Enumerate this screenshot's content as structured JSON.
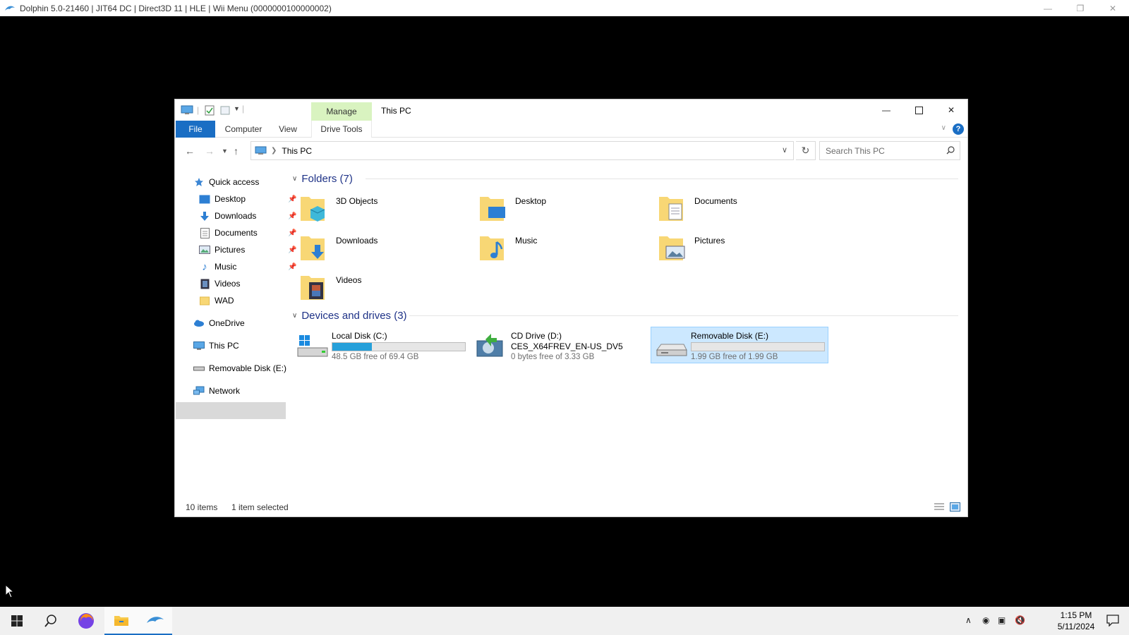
{
  "dolphin": {
    "title": "Dolphin 5.0-21460 | JIT64 DC | Direct3D 11 | HLE | Wii Menu (0000000100000002)"
  },
  "explorer": {
    "window_title": "This PC",
    "ribbon": {
      "contextual_group": "Manage",
      "tabs": {
        "file": "File",
        "computer": "Computer",
        "view": "View",
        "drive_tools": "Drive Tools"
      },
      "help": "?"
    },
    "address": {
      "crumb": "This PC",
      "search_placeholder": "Search This PC"
    },
    "nav_pane": {
      "quick_access": "Quick access",
      "quick_items": [
        {
          "label": "Desktop",
          "pinned": true
        },
        {
          "label": "Downloads",
          "pinned": true
        },
        {
          "label": "Documents",
          "pinned": true
        },
        {
          "label": "Pictures",
          "pinned": true
        },
        {
          "label": "Music",
          "pinned": true
        },
        {
          "label": "Videos",
          "pinned": false
        },
        {
          "label": "WAD",
          "pinned": false
        }
      ],
      "onedrive": "OneDrive",
      "this_pc": "This PC",
      "removable": "Removable Disk (E:)",
      "network": "Network"
    },
    "folders": {
      "header": "Folders (7)",
      "items": [
        "3D Objects",
        "Desktop",
        "Documents",
        "Downloads",
        "Music",
        "Pictures",
        "Videos"
      ]
    },
    "drives": {
      "header": "Devices and drives (3)",
      "items": [
        {
          "name": "Local Disk (C:)",
          "free_text": "48.5 GB free of 69.4 GB",
          "used_fraction": 0.3
        },
        {
          "name": "CD Drive (D:)",
          "label": "CES_X64FREV_EN-US_DV5",
          "free_text": "0 bytes free of 3.33 GB"
        },
        {
          "name": "Removable Disk (E:)",
          "free_text": "1.99 GB free of 1.99 GB",
          "used_fraction": 0.0,
          "selected": true
        }
      ]
    },
    "status": {
      "count": "10 items",
      "selected": "1 item selected"
    }
  },
  "taskbar": {
    "time": "1:15 PM",
    "date": "5/11/2024"
  },
  "colors": {
    "accent": "#1a6ec4",
    "manage_tab": "#d9f3c0",
    "selection": "#cce8ff",
    "bar_fill": "#26a0da",
    "group_header": "#1e3287"
  }
}
